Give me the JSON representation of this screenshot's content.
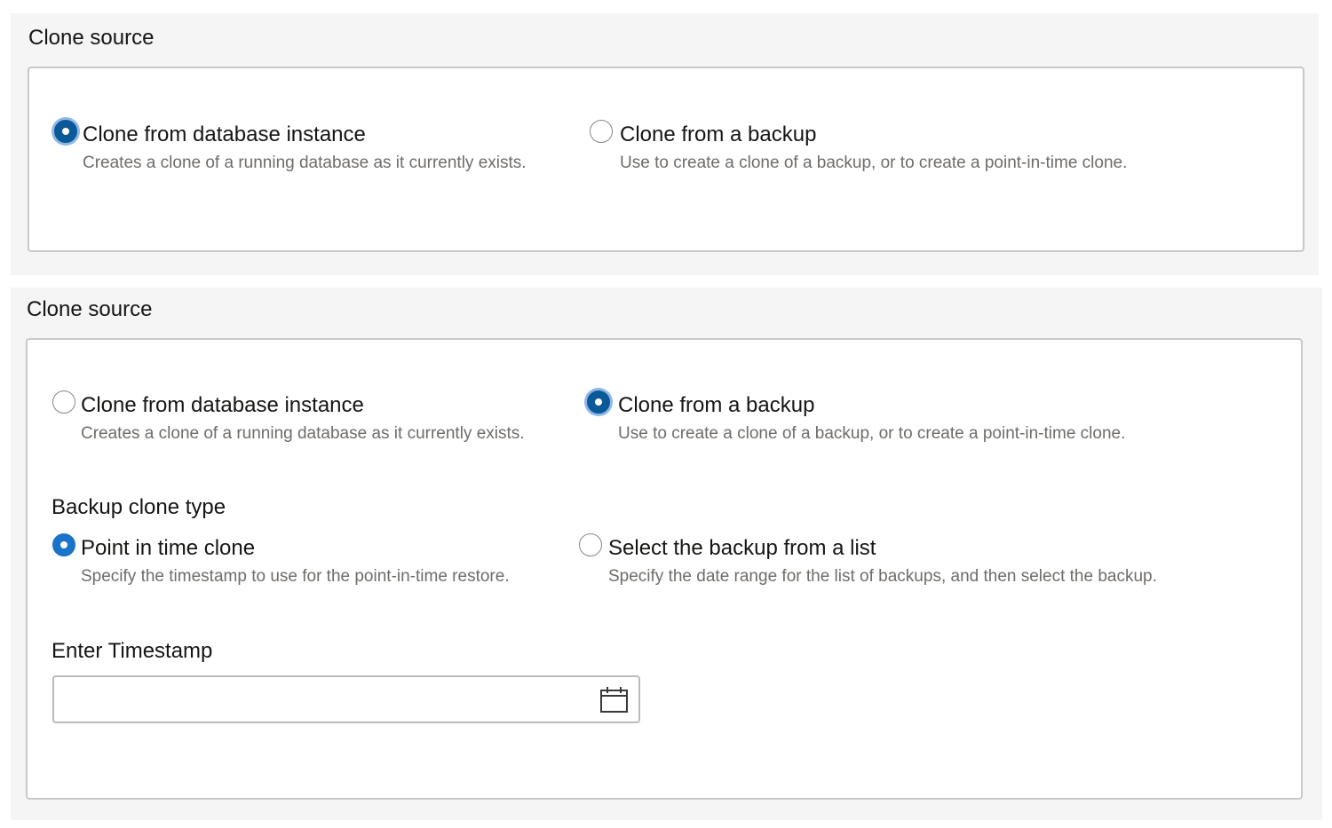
{
  "panel1": {
    "title": "Clone source",
    "options": [
      {
        "label": "Clone from database instance",
        "description": "Creates a clone of a running database as it currently exists.",
        "selected": true
      },
      {
        "label": "Clone from a backup",
        "description": "Use to create a clone of a backup, or to create a point-in-time clone.",
        "selected": false
      }
    ]
  },
  "panel2": {
    "title": "Clone source",
    "options": [
      {
        "label": "Clone from database instance",
        "description": "Creates a clone of a running database as it currently exists.",
        "selected": false
      },
      {
        "label": "Clone from a backup",
        "description": "Use to create a clone of a backup, or to create a point-in-time clone.",
        "selected": true
      }
    ],
    "backup_clone_type": {
      "label": "Backup clone type",
      "options": [
        {
          "label": "Point in time clone",
          "description": "Specify the timestamp to use for the point-in-time restore.",
          "selected": true
        },
        {
          "label": "Select the backup from a list",
          "description": "Specify the date range for the list of backups, and then select the backup.",
          "selected": false
        }
      ]
    },
    "timestamp": {
      "label": "Enter Timestamp",
      "value": "",
      "icon": "calendar-icon"
    }
  },
  "colors": {
    "panel_background": "#f5f5f5",
    "box_border": "#c9c9cc",
    "radio_selected": "#1a73c8",
    "radio_focused": "#0b5a97",
    "focus_ring": "#8fb7e8",
    "description_text": "#6f6c69"
  }
}
